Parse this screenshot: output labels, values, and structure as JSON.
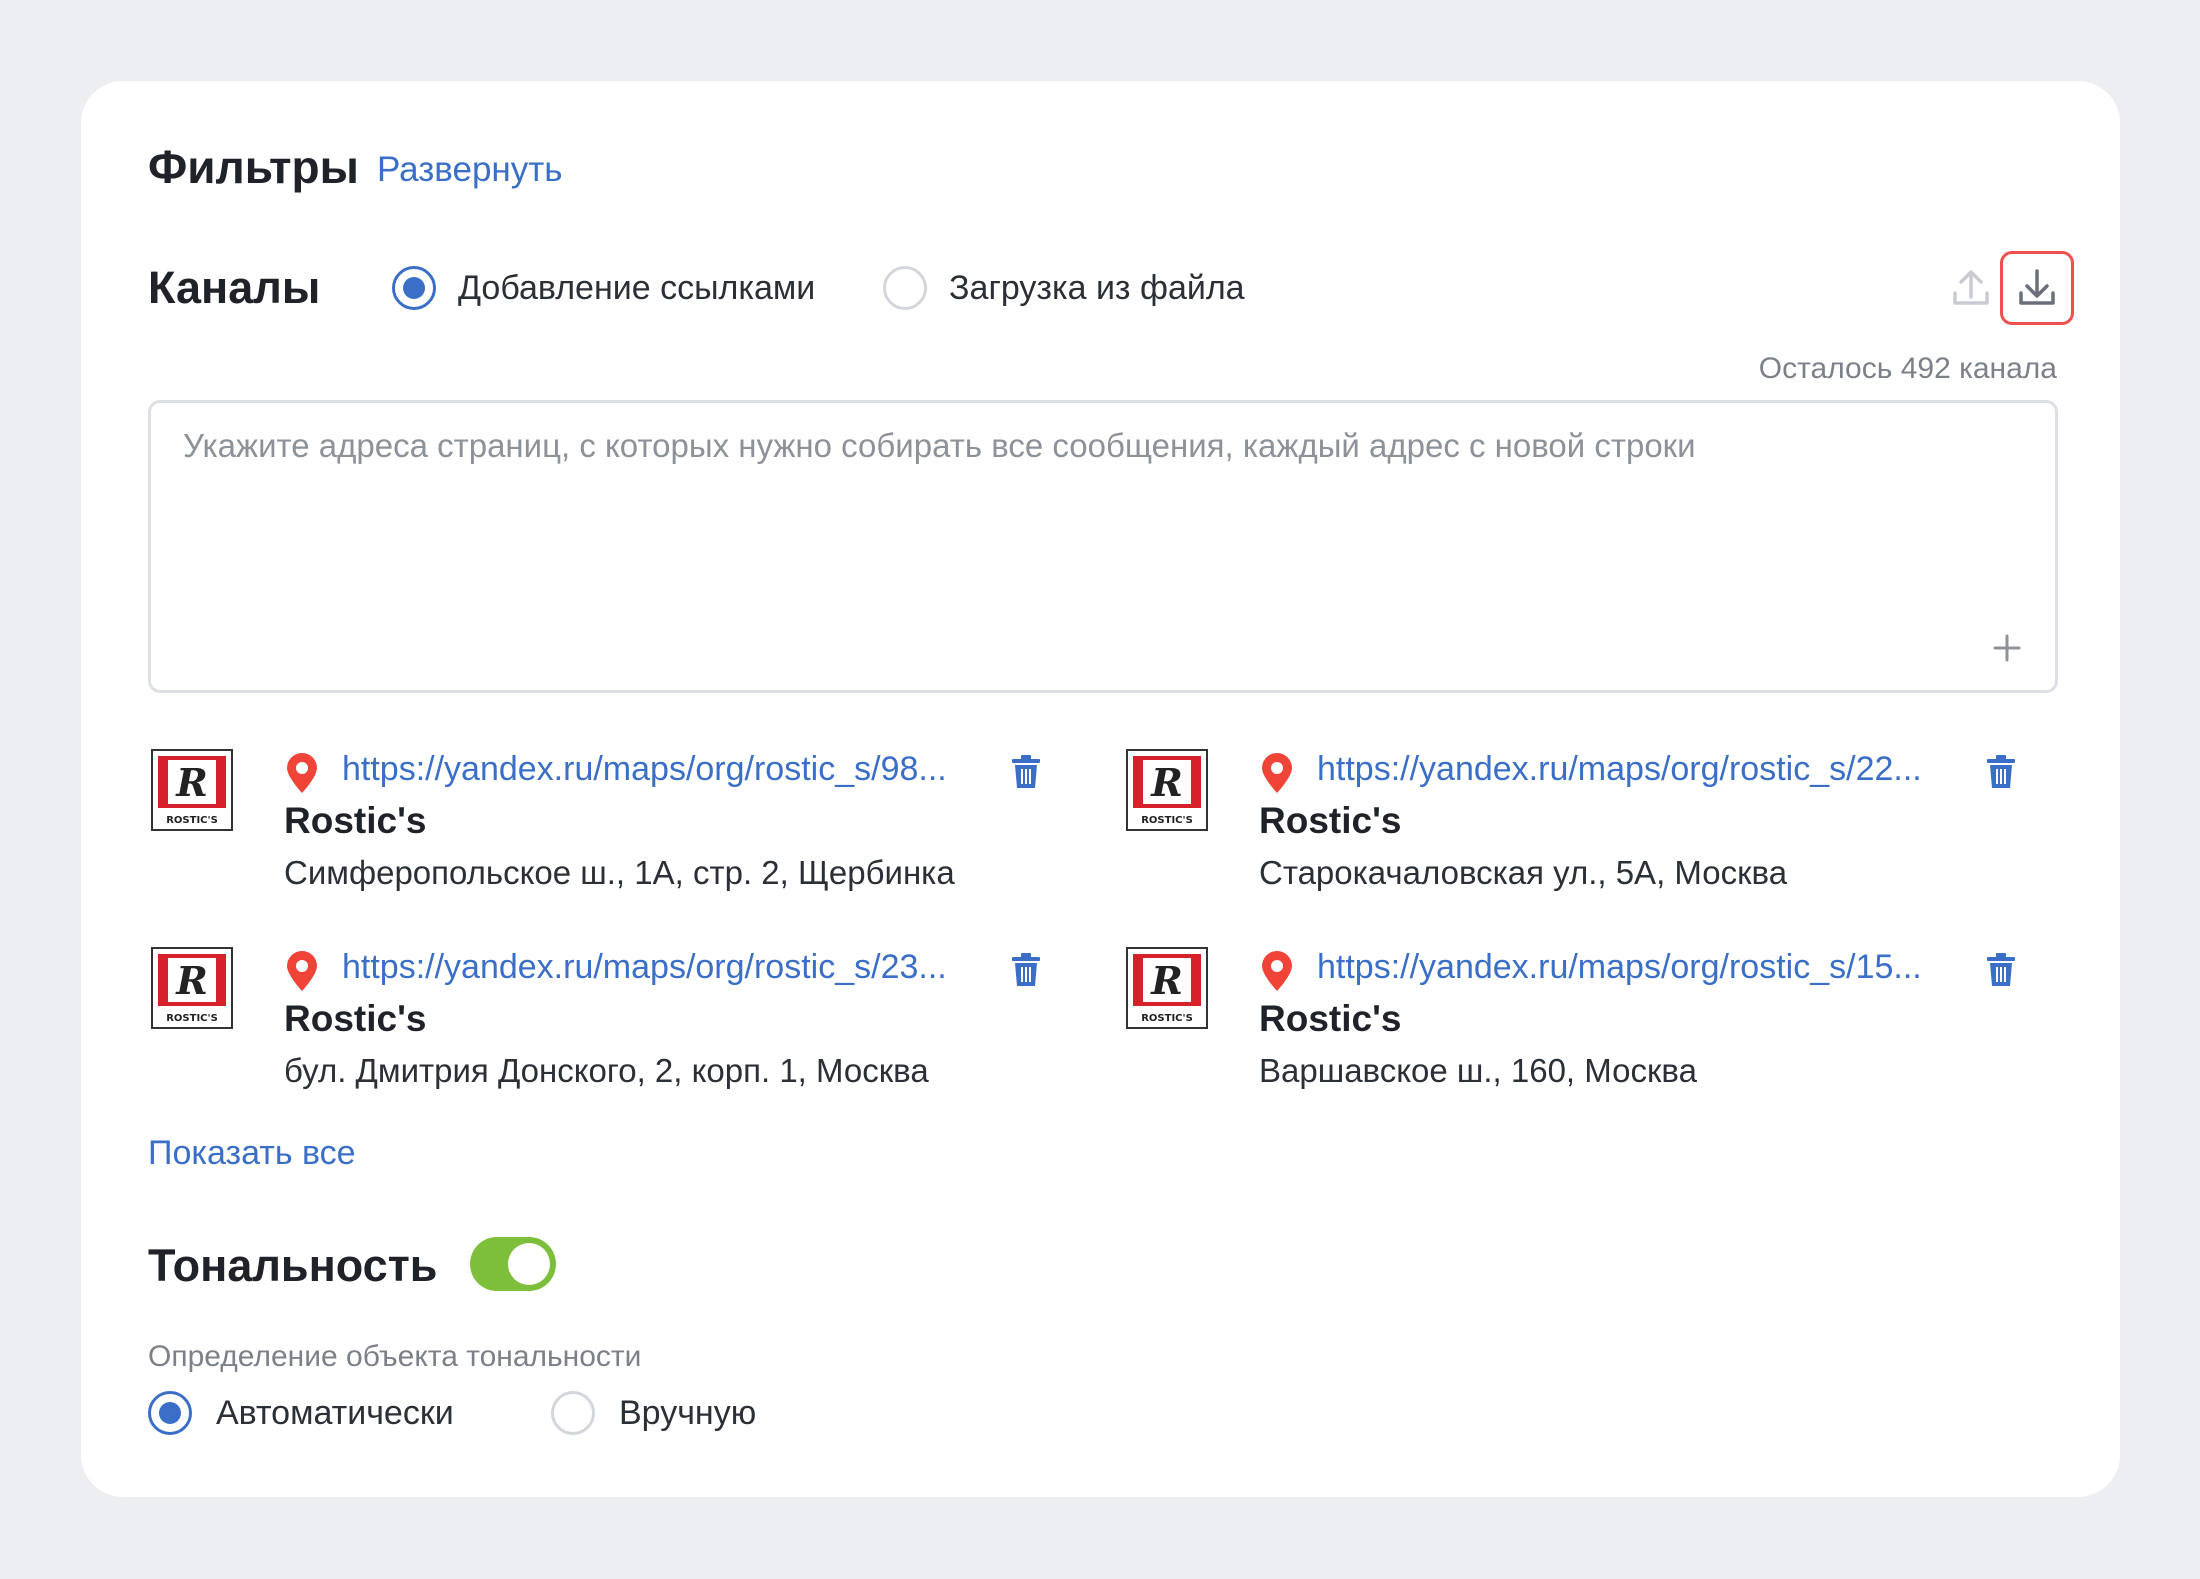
{
  "filters": {
    "title": "Фильтры",
    "expand_label": "Развернуть"
  },
  "channels": {
    "title": "Каналы",
    "mode_options": [
      {
        "label": "Добавление ссылками",
        "selected": true
      },
      {
        "label": "Загрузка из файла",
        "selected": false
      }
    ],
    "upload_icon": "upload-icon",
    "download_icon": "download-icon",
    "remaining_text": "Осталось 492 канала",
    "textarea": {
      "value": "",
      "placeholder": "Укажите адреса страниц, с которых нужно собирать все сообщения, каждый адрес с новой строки"
    },
    "items": [
      {
        "url": "https://yandex.ru/maps/org/rostic_s/98...",
        "name": "Rostic's",
        "address": "Симферопольское ш., 1А, стр. 2, Щербинка"
      },
      {
        "url": "https://yandex.ru/maps/org/rostic_s/22...",
        "name": "Rostic's",
        "address": "Старокачаловская ул., 5А, Москва"
      },
      {
        "url": "https://yandex.ru/maps/org/rostic_s/23...",
        "name": "Rostic's",
        "address": "бул. Дмитрия Донского, 2, корп. 1, Москва"
      },
      {
        "url": "https://yandex.ru/maps/org/rostic_s/15...",
        "name": "Rostic's",
        "address": "Варшавское ш., 160, Москва"
      }
    ],
    "logo_text": "ROSTIC'S",
    "show_all_label": "Показать все"
  },
  "tonality": {
    "title": "Тональность",
    "enabled": true,
    "object_label": "Определение объекта тональности",
    "options": [
      {
        "label": "Автоматически",
        "selected": true
      },
      {
        "label": "Вручную",
        "selected": false
      }
    ]
  },
  "colors": {
    "accent": "#3b6fc7",
    "toggle_on": "#7dbf3a",
    "active_outline": "#ef4f4f",
    "pin": "#f04438",
    "background": "#eceef1"
  }
}
